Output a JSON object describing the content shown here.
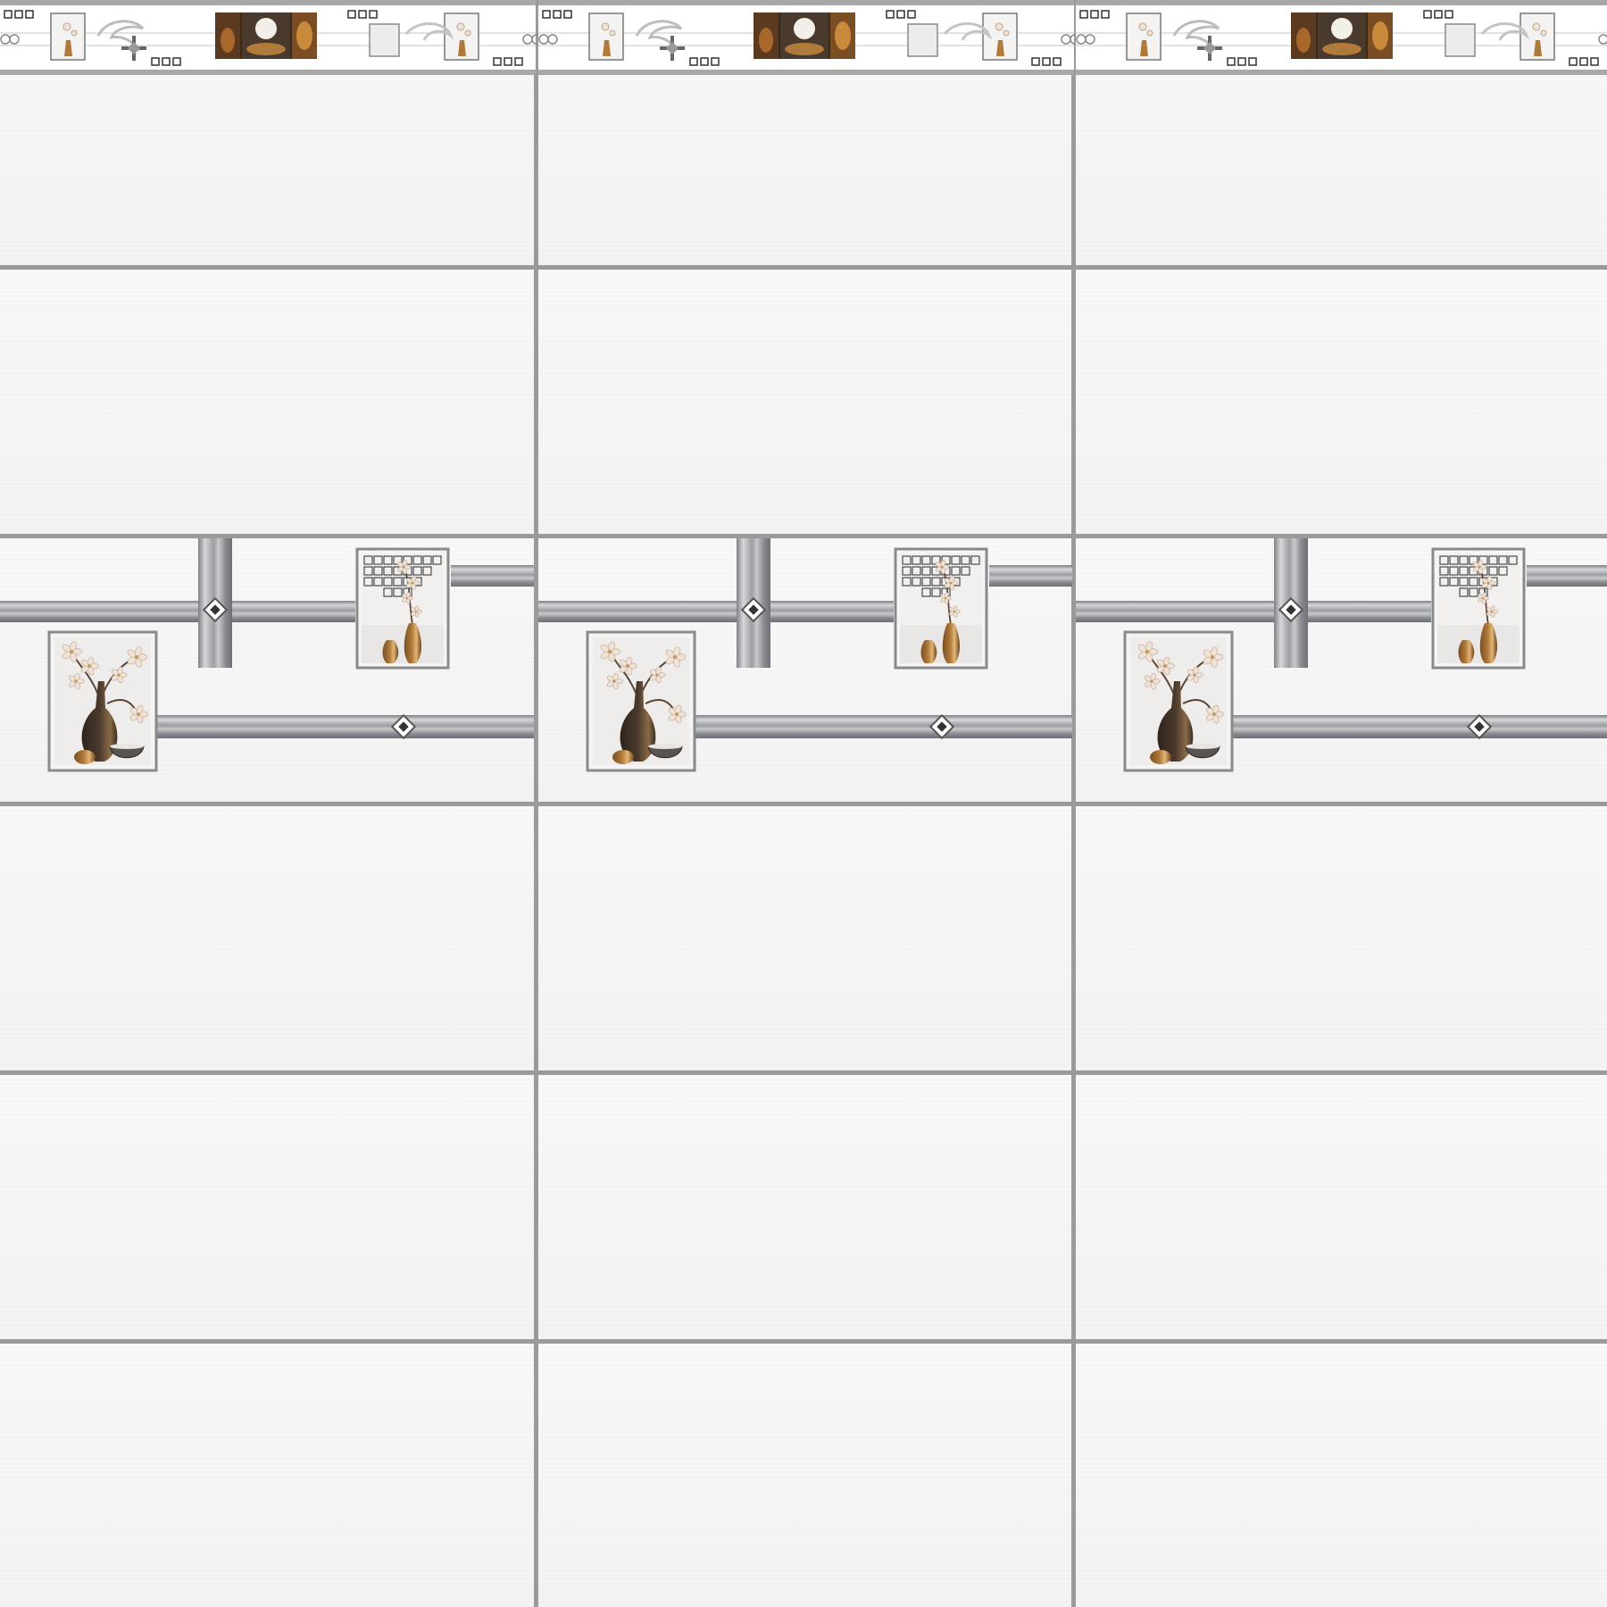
{
  "wall": {
    "tile_columns": 3,
    "tile_rows": 6,
    "decor_row": 3,
    "border_panels": 3,
    "colors": {
      "grout": "#9a9a9a",
      "tile": "#f4f4f5",
      "rail": "#8f9094",
      "rail_highlight": "#d6d7da",
      "frame": "#8a8a8c",
      "vase_dark": "#4b3a2c",
      "vase_gold": "#b07a3a",
      "blossom": "#efe3d8",
      "border_band": "#ffffff",
      "border_edge": "#a8a8a8"
    }
  },
  "icons": {
    "large_picture": "vase-with-magnolia-icon",
    "small_picture": "gold-vases-with-orchid-icon",
    "diamond": "diamond-ornament-icon",
    "border_scene": "still-life-triptych-icon",
    "border_scroll": "silver-scroll-ornament-icon"
  }
}
